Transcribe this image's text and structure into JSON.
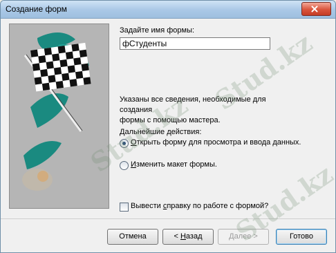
{
  "window": {
    "title": "Создание форм"
  },
  "form_name": {
    "label": "Задайте имя формы:",
    "value": "фСтуденты"
  },
  "info": {
    "line1": "Указаны все сведения, необходимые для создания",
    "line2": "формы с помощью мастера.",
    "next_actions": "Дальнейшие действия:"
  },
  "options": {
    "open_form": {
      "underline": "О",
      "rest": "ткрыть форму для просмотра и ввода данных.",
      "selected": true
    },
    "modify_layout": {
      "underline": "И",
      "rest": "зменить макет формы.",
      "selected": false
    }
  },
  "help_checkbox": {
    "pre": "Вывести ",
    "underline": "с",
    "rest": "правку по работе с формой?",
    "checked": false
  },
  "buttons": {
    "cancel": "Отмена",
    "back_arrow": "< ",
    "back_underline": "Н",
    "back_rest": "азад",
    "next": "Далее >",
    "finish": "Готово"
  },
  "watermark_text": "Stud.kz"
}
